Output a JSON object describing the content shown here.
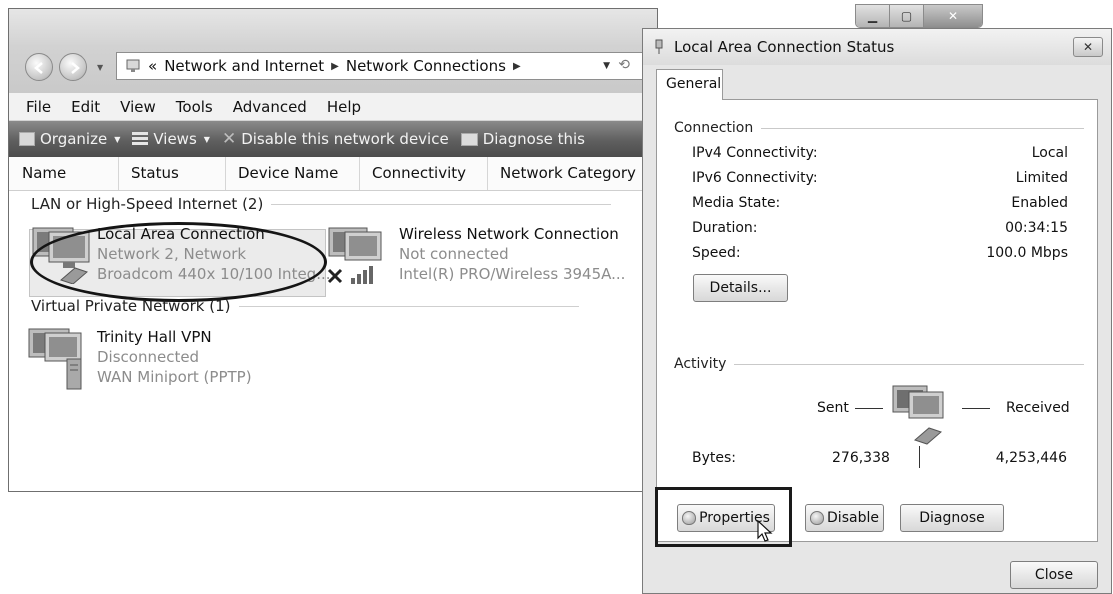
{
  "explorer": {
    "address": {
      "prefix": "«",
      "crumbs": [
        "Network and Internet",
        "Network Connections"
      ]
    },
    "menu": [
      "File",
      "Edit",
      "View",
      "Tools",
      "Advanced",
      "Help"
    ],
    "toolbar": {
      "organize": "Organize",
      "views": "Views",
      "disable": "Disable this network device",
      "diagnose": "Diagnose this"
    },
    "columns": [
      "Name",
      "Status",
      "Device Name",
      "Connectivity",
      "Network Category"
    ],
    "groups": [
      {
        "title": "LAN or High-Speed Internet (2)",
        "items": [
          {
            "name": "Local Area Connection",
            "status": "Network  2, Network",
            "device": "Broadcom 440x 10/100 Integ..."
          },
          {
            "name": "Wireless Network Connection",
            "status": "Not connected",
            "device": "Intel(R) PRO/Wireless 3945A..."
          }
        ]
      },
      {
        "title": "Virtual Private Network (1)",
        "items": [
          {
            "name": "Trinity Hall VPN",
            "status": "Disconnected",
            "device": "WAN Miniport (PPTP)"
          }
        ]
      }
    ]
  },
  "dialog": {
    "title": "Local Area Connection Status",
    "tab": "General",
    "connection": {
      "heading": "Connection",
      "rows": [
        {
          "label": "IPv4 Connectivity:",
          "value": "Local"
        },
        {
          "label": "IPv6 Connectivity:",
          "value": "Limited"
        },
        {
          "label": "Media State:",
          "value": "Enabled"
        },
        {
          "label": "Duration:",
          "value": "00:34:15"
        },
        {
          "label": "Speed:",
          "value": "100.0 Mbps"
        }
      ],
      "details_button": "Details..."
    },
    "activity": {
      "heading": "Activity",
      "sent_label": "Sent",
      "received_label": "Received",
      "bytes_label": "Bytes:",
      "bytes_sent": "276,338",
      "bytes_received": "4,253,446"
    },
    "buttons": {
      "properties": "Properties",
      "disable": "Disable",
      "diagnose": "Diagnose",
      "close": "Close"
    }
  }
}
